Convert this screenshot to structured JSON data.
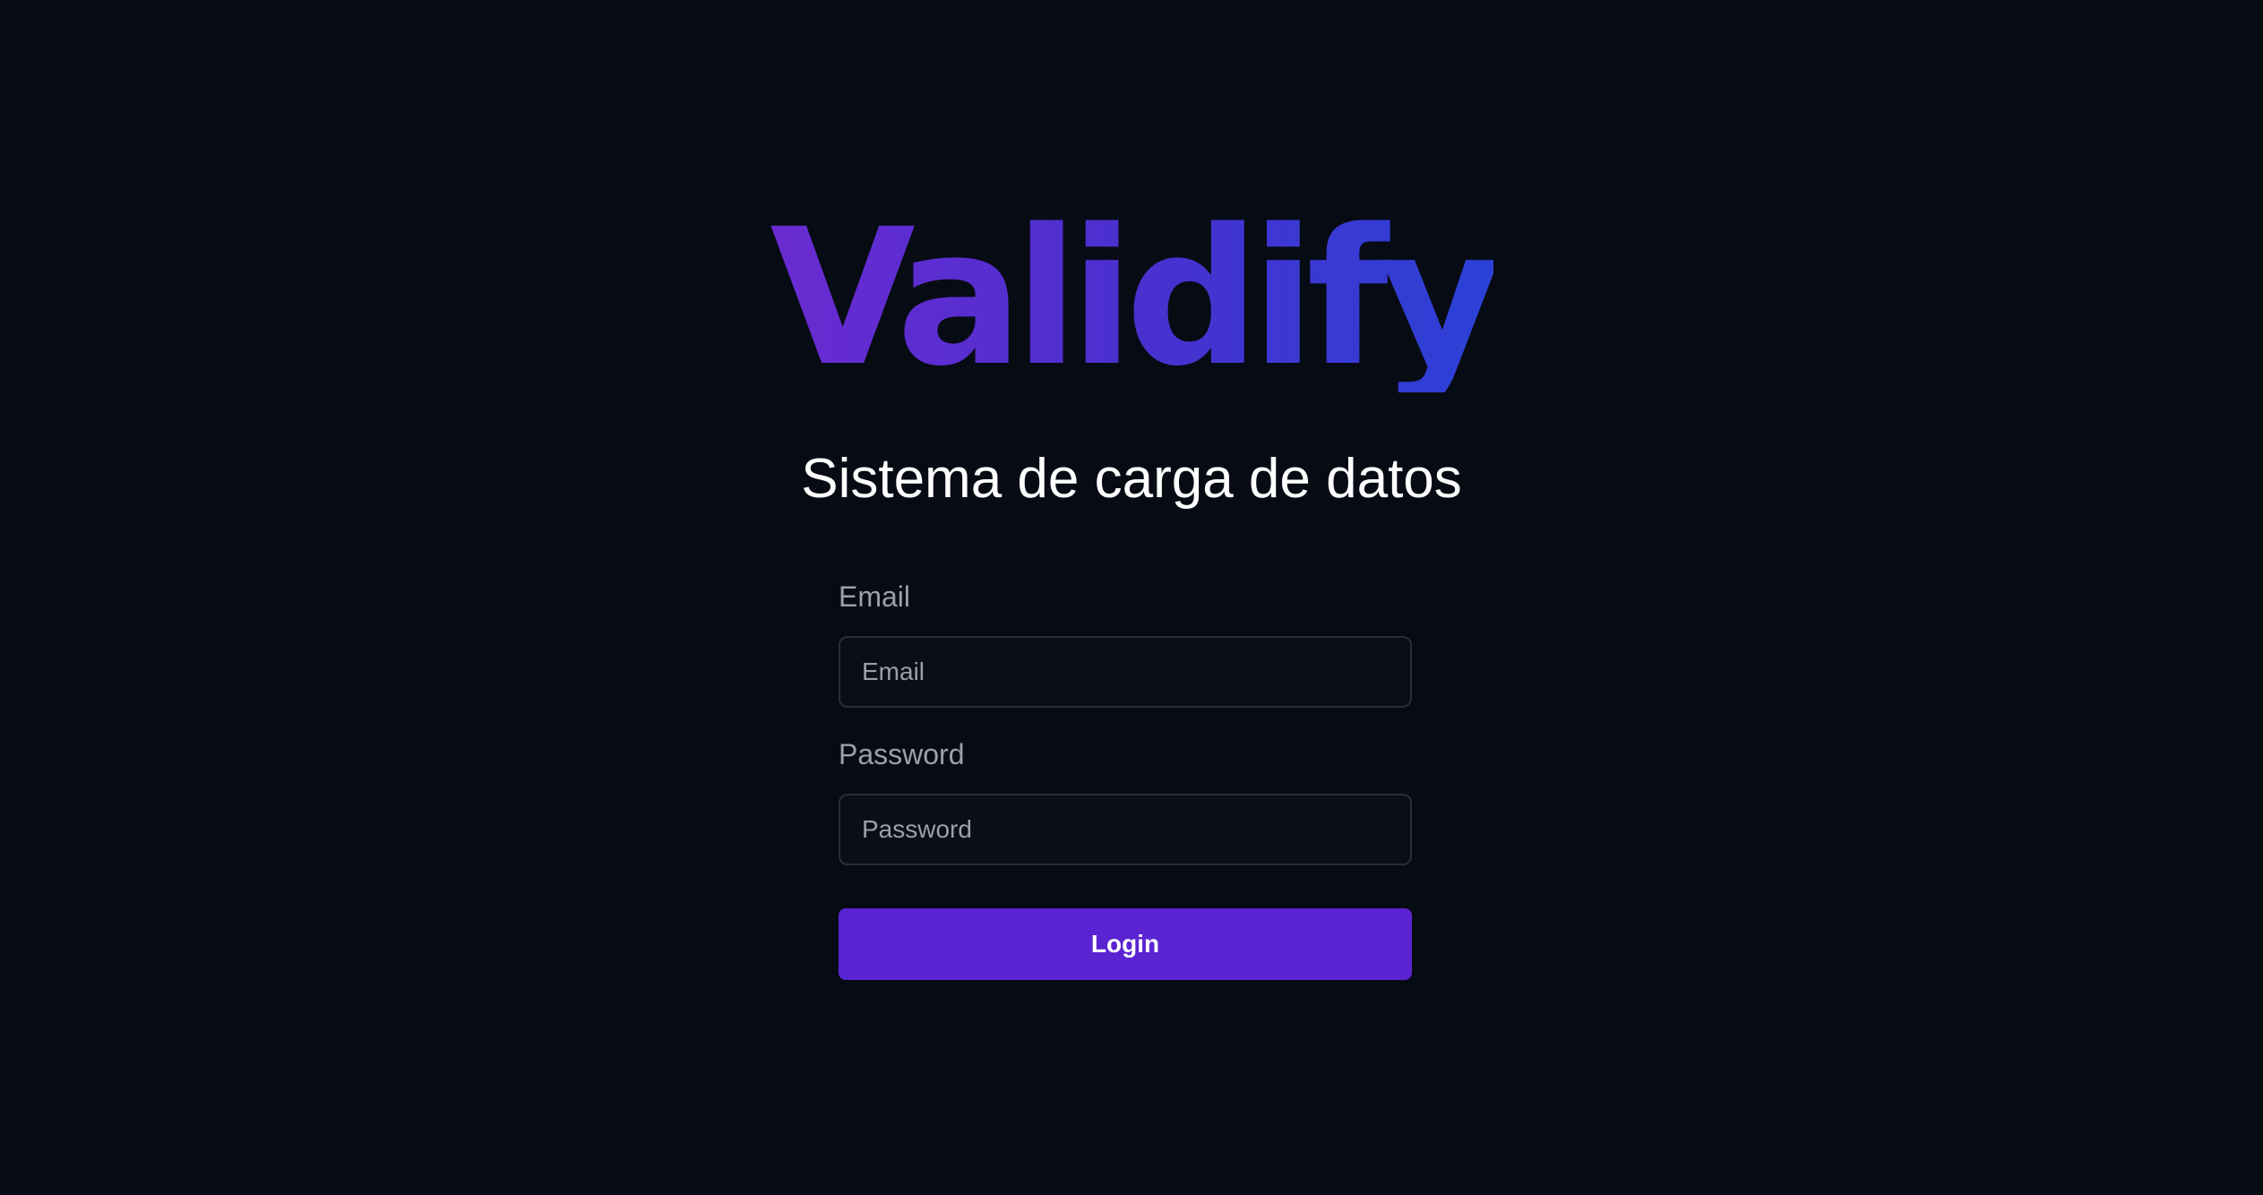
{
  "brand": {
    "logo_text": "Validify",
    "gradient_colors": [
      "#6a2bd0",
      "#4a30cf",
      "#2b41d6"
    ]
  },
  "page": {
    "subtitle": "Sistema de carga de datos",
    "background_color": "#070b14"
  },
  "login_form": {
    "email_label": "Email",
    "email_value": "",
    "email_placeholder": "Email",
    "password_label": "Password",
    "password_value": "",
    "password_placeholder": "Password",
    "login_label": "Login",
    "button_color": "#5b24d2"
  }
}
